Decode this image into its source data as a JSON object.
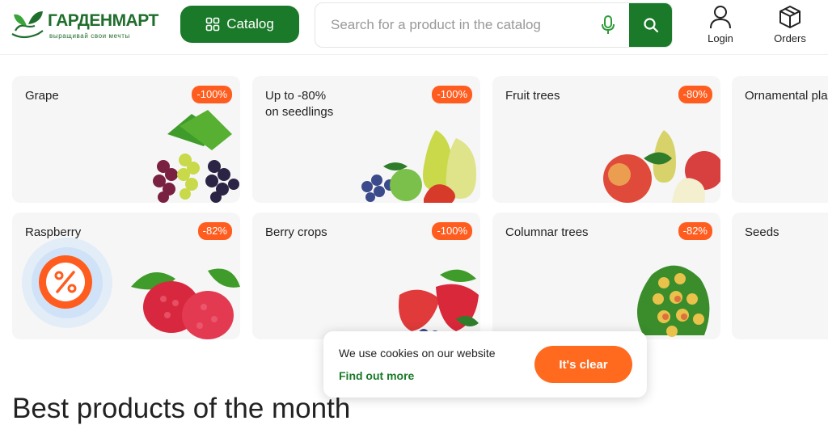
{
  "header": {
    "logo_title": "ГАРДЕНМАРТ",
    "logo_subtitle": "выращивай свои мечты",
    "catalog_label": "Catalog",
    "search_placeholder": "Search for a product in the catalog",
    "login_label": "Login",
    "orders_label": "Orders"
  },
  "cards": [
    {
      "title": "Grape",
      "badge": "-100%"
    },
    {
      "title": "Up to -80%\non seedlings",
      "badge": "-100%"
    },
    {
      "title": "Fruit trees",
      "badge": "-80%"
    },
    {
      "title": "Ornamental plants",
      "badge": ""
    },
    {
      "title": "Raspberry",
      "badge": "-82%"
    },
    {
      "title": "Berry crops",
      "badge": "-100%"
    },
    {
      "title": "Columnar trees",
      "badge": "-82%"
    },
    {
      "title": "Seeds",
      "badge": ""
    }
  ],
  "cookie": {
    "text": "We use cookies on our website",
    "link": "Find out more",
    "button": "It's clear"
  },
  "section": {
    "title": "Best products of the month"
  },
  "colors": {
    "brand_green": "#1b7a2a",
    "accent_orange": "#ff5d1f",
    "card_bg": "#f6f6f6"
  }
}
